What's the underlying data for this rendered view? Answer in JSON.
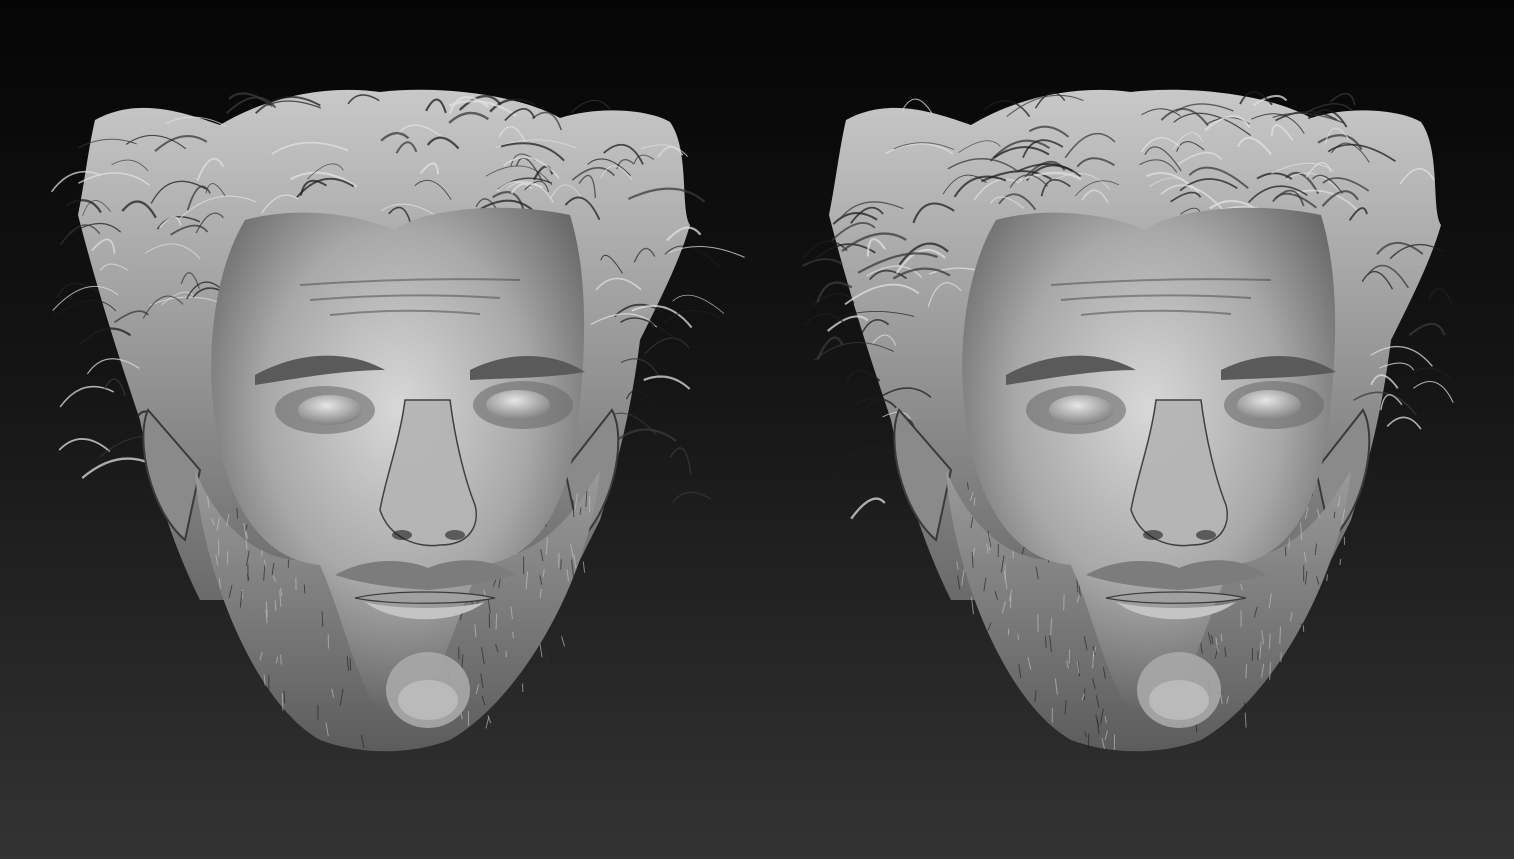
{
  "viewport": {
    "background_top": "#050505",
    "background_bottom": "#333333"
  },
  "material": {
    "base": "#8f8f8f",
    "highlight": "#d8d8d8",
    "shadow": "#3a3a3a",
    "deep_shadow": "#1e1e1e"
  },
  "sculpts": [
    {
      "name": "head-sculpt-left"
    },
    {
      "name": "head-sculpt-right"
    }
  ]
}
